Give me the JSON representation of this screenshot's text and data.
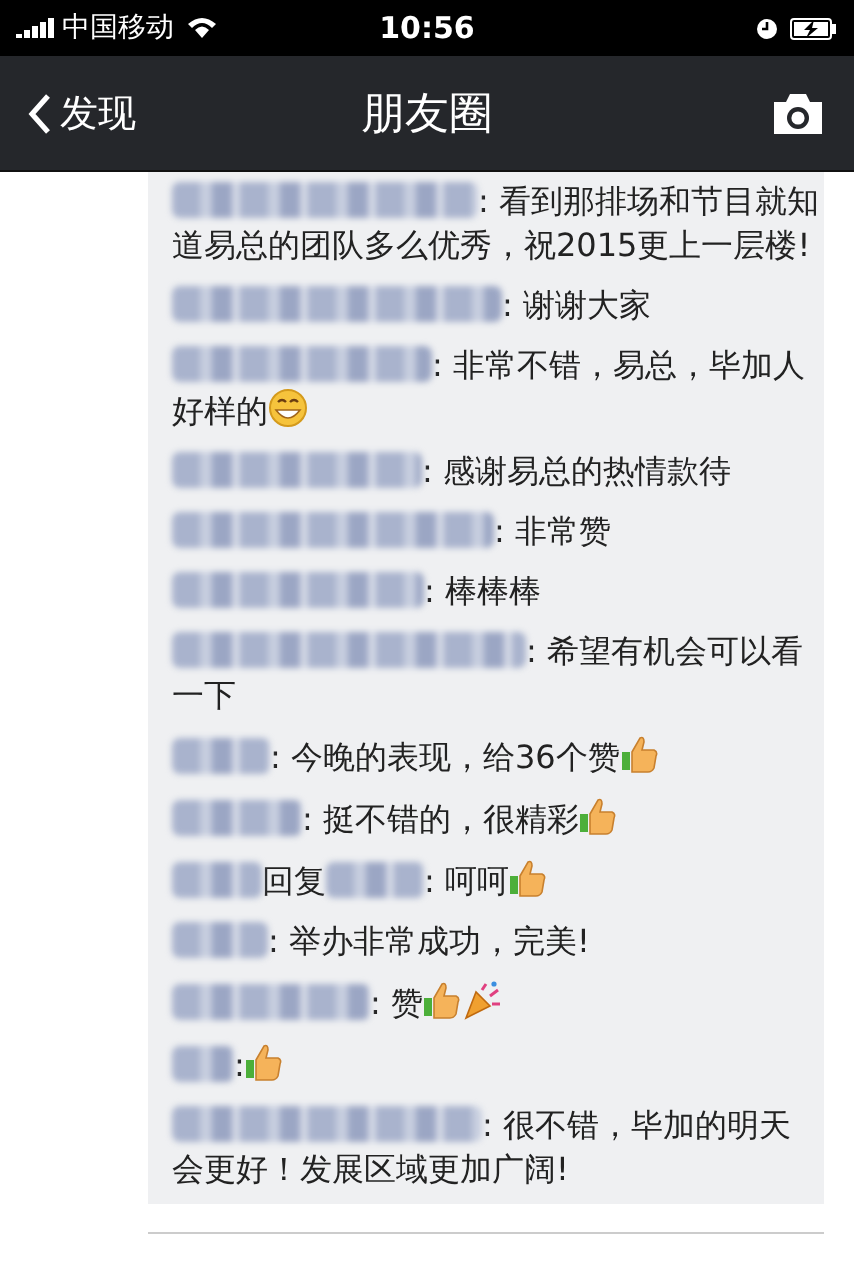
{
  "status_bar": {
    "carrier": "中国移动",
    "time": "10:56"
  },
  "nav": {
    "back": "发现",
    "title": "朋友圈"
  },
  "comments": [
    {
      "kind": "comment",
      "text": ": 看到那排场和节目就知道易总的团队多么优秀，祝2015更上一层楼!"
    },
    {
      "kind": "comment",
      "text": ": 谢谢大家"
    },
    {
      "kind": "comment",
      "text": ": 非常不错，易总，毕加人好样的",
      "emoji": [
        {
          "kind": "grin"
        }
      ]
    },
    {
      "kind": "comment",
      "text": ": 感谢易总的热情款待"
    },
    {
      "kind": "comment",
      "text": ": 非常赞"
    },
    {
      "kind": "comment",
      "text": ": 棒棒棒"
    },
    {
      "kind": "comment",
      "text": ": 希望有机会可以看一下"
    },
    {
      "kind": "comment",
      "text": ": 今晚的表现，给36个赞",
      "emoji": [
        {
          "kind": "thumbs_up"
        }
      ]
    },
    {
      "kind": "comment",
      "text": ": 挺不错的，很精彩",
      "emoji": [
        {
          "kind": "thumbs_up"
        }
      ]
    },
    {
      "kind": "reply",
      "reply_word": "回复",
      "text": ": 呵呵",
      "emoji": [
        {
          "kind": "thumbs_up"
        }
      ]
    },
    {
      "kind": "comment",
      "text": ": 举办非常成功，完美!"
    },
    {
      "kind": "comment",
      "text": ": 赞",
      "emoji": [
        {
          "kind": "thumbs_up"
        },
        {
          "kind": "party"
        }
      ]
    },
    {
      "kind": "comment",
      "text": ":",
      "emoji": [
        {
          "kind": "thumbs_up"
        }
      ]
    },
    {
      "kind": "comment",
      "text": ": 很不错，毕加的明天会更好！发展区域更加广阔!"
    }
  ]
}
